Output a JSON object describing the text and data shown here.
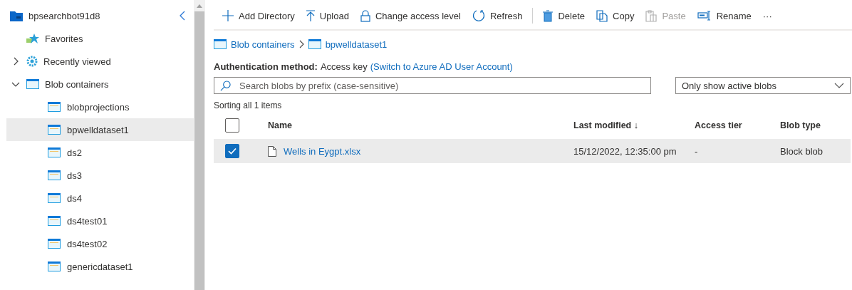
{
  "sidebar": {
    "account": "bpsearchbot91d8",
    "tree": [
      {
        "label": "Favorites",
        "kind": "favorites"
      },
      {
        "label": "Recently viewed",
        "kind": "recent",
        "expanded": false
      },
      {
        "label": "Blob containers",
        "kind": "container",
        "expanded": true,
        "children": [
          {
            "label": "blobprojections",
            "selected": false
          },
          {
            "label": "bpwelldataset1",
            "selected": true
          },
          {
            "label": "ds2",
            "selected": false
          },
          {
            "label": "ds3",
            "selected": false
          },
          {
            "label": "ds4",
            "selected": false
          },
          {
            "label": "ds4test01",
            "selected": false
          },
          {
            "label": "ds4test02",
            "selected": false
          },
          {
            "label": "genericdataset1",
            "selected": false
          }
        ]
      }
    ]
  },
  "toolbar": {
    "groups": [
      {
        "items": [
          {
            "label": "Add Directory",
            "kind": "add",
            "disabled": false
          },
          {
            "label": "Upload",
            "kind": "upload",
            "disabled": false
          },
          {
            "label": "Change access level",
            "kind": "lock",
            "disabled": false
          },
          {
            "label": "Refresh",
            "kind": "refresh",
            "disabled": false
          }
        ]
      },
      {
        "items": [
          {
            "label": "Delete",
            "kind": "delete",
            "disabled": false
          },
          {
            "label": "Copy",
            "kind": "copy",
            "disabled": false
          },
          {
            "label": "Paste",
            "kind": "paste",
            "disabled": true
          },
          {
            "label": "Rename",
            "kind": "rename",
            "disabled": false
          },
          {
            "label": "···",
            "kind": "more",
            "disabled": false
          }
        ]
      }
    ]
  },
  "breadcrumb": [
    "Blob containers",
    "bpwelldataset1"
  ],
  "auth": {
    "label": "Authentication method:",
    "value": "Access key",
    "link": "(Switch to Azure AD User Account)"
  },
  "search": {
    "placeholder": "Search blobs by prefix (case-sensitive)"
  },
  "filter": {
    "value": "Only show active blobs"
  },
  "sort_info": "Sorting all 1 items",
  "table": {
    "all_checked": false,
    "columns": [
      "Name",
      "Last modified ↓",
      "Access tier",
      "Blob type"
    ],
    "rows": [
      {
        "selected": true,
        "name": "Wells in Eygpt.xlsx",
        "modified": "15/12/2022, 12:35:00 pm",
        "tier": "-",
        "type": "Block blob"
      }
    ]
  }
}
